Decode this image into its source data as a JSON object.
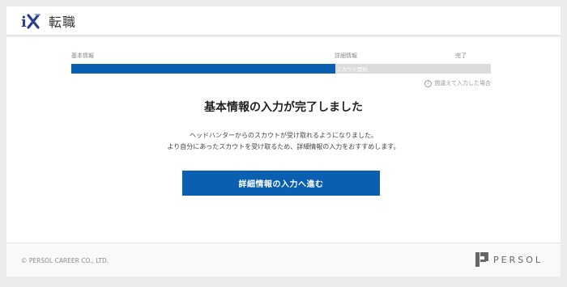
{
  "header": {
    "logo_mark": "iX",
    "brand": "転職"
  },
  "steps": {
    "step1": "基本情報",
    "step2": "詳細情報",
    "step3": "完了",
    "current_tag": "スカウト開始",
    "progress_fraction": 0.63
  },
  "help_link": "間違えて入力した場合",
  "main": {
    "title": "基本情報の入力が完了しました",
    "desc_line1": "ヘッドハンターからのスカウトが受け取れるようになりました。",
    "desc_line2": "より自分にあったスカウトを受け取るため、詳細情報の入力をおすすめします。",
    "cta_label": "詳細情報の入力へ進む"
  },
  "footer": {
    "copyright": "© PERSOL CAREER CO., LTD.",
    "persol_logo": "PERSOL"
  },
  "colors": {
    "primary": "#0a5fb1",
    "track": "#dcdcdc",
    "background": "#ececec"
  }
}
